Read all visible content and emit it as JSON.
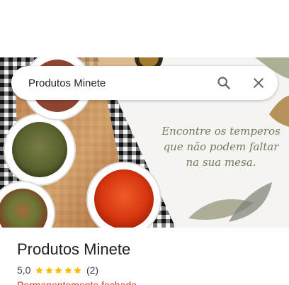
{
  "search": {
    "value": "Produtos Minete",
    "search_icon": "search-icon",
    "clear_icon": "close-icon"
  },
  "hero": {
    "tagline": [
      "Encontre os temperos",
      "que não podem faltar",
      "na sua mesa."
    ]
  },
  "place": {
    "name": "Produtos Minete",
    "rating": "5,0",
    "stars": 5,
    "reviews": "(2)",
    "status": "Permanentemente fechado"
  },
  "colors": {
    "star": "#fbbc04",
    "status": "#d93025",
    "text": "#202124",
    "tagline": "#6f7c59"
  }
}
